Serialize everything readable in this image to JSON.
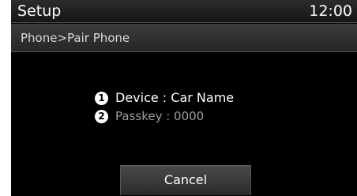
{
  "header": {
    "title": "Setup",
    "clock": "12:00"
  },
  "breadcrumb": {
    "path": "Phone>Pair Phone"
  },
  "pairing": {
    "device_marker": "1",
    "device_text": "Device : Car Name",
    "passkey_marker": "2",
    "passkey_text": "Passkey : 0000"
  },
  "actions": {
    "cancel_label": "Cancel"
  },
  "colors": {
    "background": "#000000",
    "primary_text": "#ffffff",
    "secondary_text": "#9e9e9e"
  }
}
